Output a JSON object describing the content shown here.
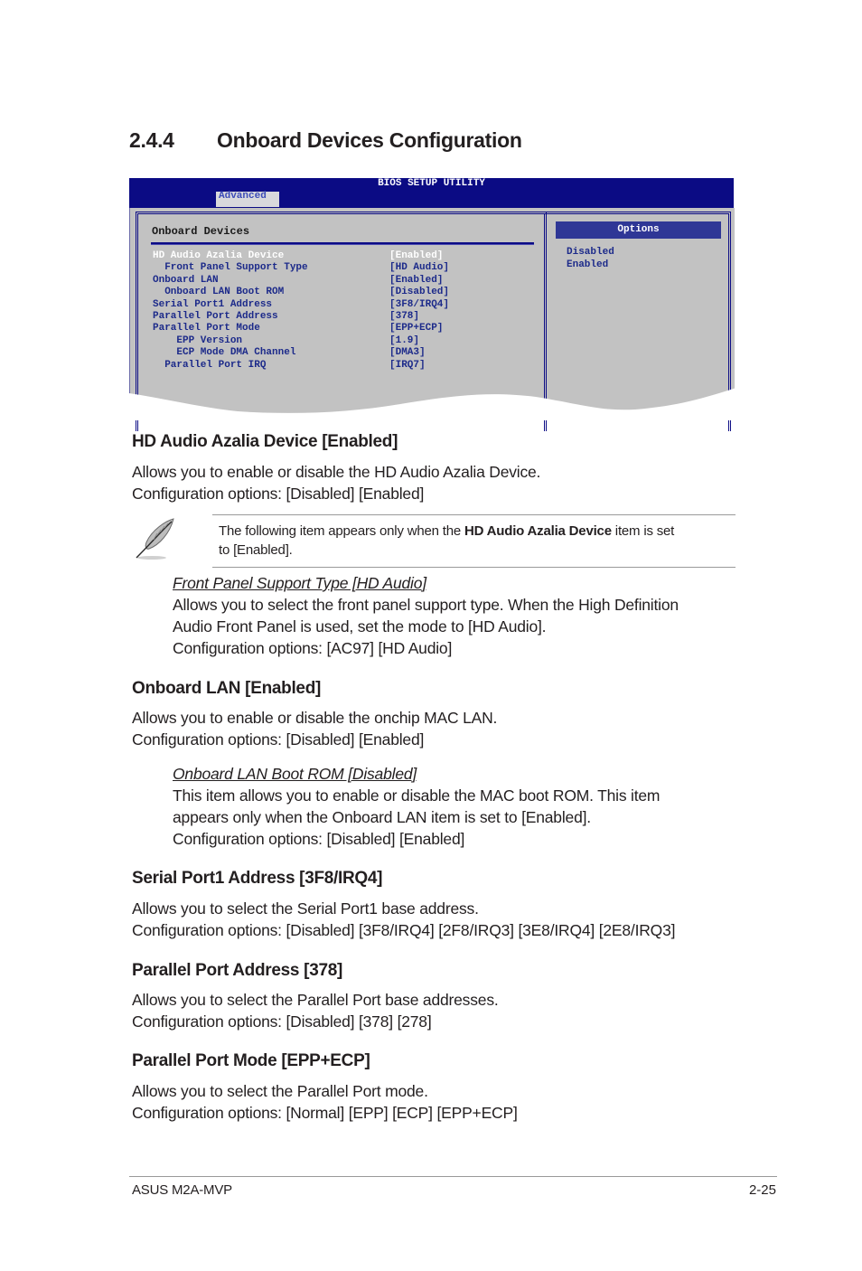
{
  "section": {
    "number": "2.4.4",
    "title": "Onboard Devices Configuration"
  },
  "bios": {
    "utility_title": "BIOS SETUP UTILITY",
    "active_tab": "Advanced",
    "panel_heading": "Onboard Devices",
    "items": [
      {
        "label": "HD Audio Azalia Device",
        "value": "[Enabled]",
        "indent": 0,
        "selected": true
      },
      {
        "label": "  Front Panel Support Type",
        "value": "[HD Audio]",
        "indent": 1,
        "selected": false
      },
      {
        "label": "Onboard LAN",
        "value": "[Enabled]",
        "indent": 0,
        "selected": false
      },
      {
        "label": "  Onboard LAN Boot ROM",
        "value": "[Disabled]",
        "indent": 1,
        "selected": false
      },
      {
        "label": "Serial Port1 Address",
        "value": "[3F8/IRQ4]",
        "indent": 0,
        "selected": false
      },
      {
        "label": "Parallel Port Address",
        "value": "[378]",
        "indent": 0,
        "selected": false
      },
      {
        "label": "Parallel Port Mode",
        "value": "[EPP+ECP]",
        "indent": 0,
        "selected": false
      },
      {
        "label": "    EPP Version",
        "value": "[1.9]",
        "indent": 2,
        "selected": false
      },
      {
        "label": "    ECP Mode DMA Channel",
        "value": "[DMA3]",
        "indent": 2,
        "selected": false
      },
      {
        "label": "  Parallel Port IRQ",
        "value": "[IRQ7]",
        "indent": 1,
        "selected": false
      }
    ],
    "options_header": "Options",
    "options": [
      "Disabled",
      "Enabled"
    ],
    "colors": {
      "header_bg": "#0b0b84",
      "panel_bg": "#c2c2c2",
      "text": "#1c2a8a",
      "options_header_bg": "#2f3796"
    }
  },
  "hd_audio": {
    "heading": "HD Audio Azalia Device [Enabled]",
    "desc": "Allows you to enable or disable the HD Audio Azalia Device.",
    "config": "Configuration options: [Disabled] [Enabled]"
  },
  "note": {
    "icon": "feather-pen-icon",
    "text_before": "The following item appears only when the ",
    "text_bold": "HD Audio Azalia Device",
    "text_after": " item is set",
    "text_line2": "to [Enabled]."
  },
  "front_panel": {
    "title": "Front Panel Support Type [HD Audio]",
    "line1": "Allows you to select the front panel support type. When the High Definition",
    "line2": "Audio Front Panel is used, set the mode to [HD Audio].",
    "config": "Configuration options: [AC97] [HD Audio]"
  },
  "onboard_lan": {
    "heading": "Onboard LAN [Enabled]",
    "desc": "Allows you to enable or disable the onchip MAC LAN.",
    "config": "Configuration options: [Disabled] [Enabled]"
  },
  "lan_boot_rom": {
    "title": "Onboard LAN Boot ROM [Disabled]",
    "line1": "This item allows you to enable or disable the MAC boot ROM. This item",
    "line2": "appears only when the Onboard LAN item is set to [Enabled].",
    "config": "Configuration options: [Disabled] [Enabled]"
  },
  "serial_port": {
    "heading": "Serial Port1 Address [3F8/IRQ4]",
    "desc": "Allows you to select the Serial Port1 base address.",
    "config": "Configuration options: [Disabled] [3F8/IRQ4] [2F8/IRQ3] [3E8/IRQ4] [2E8/IRQ3]"
  },
  "parallel_address": {
    "heading": "Parallel Port Address [378]",
    "desc": "Allows you to select the Parallel Port base addresses.",
    "config": "Configuration options: [Disabled] [378] [278]"
  },
  "parallel_mode": {
    "heading": "Parallel Port Mode [EPP+ECP]",
    "desc": "Allows you to select the Parallel Port  mode.",
    "config": "Configuration options: [Normal] [EPP] [ECP] [EPP+ECP]"
  },
  "footer": {
    "product": "ASUS M2A-MVP",
    "page": "2-25"
  }
}
